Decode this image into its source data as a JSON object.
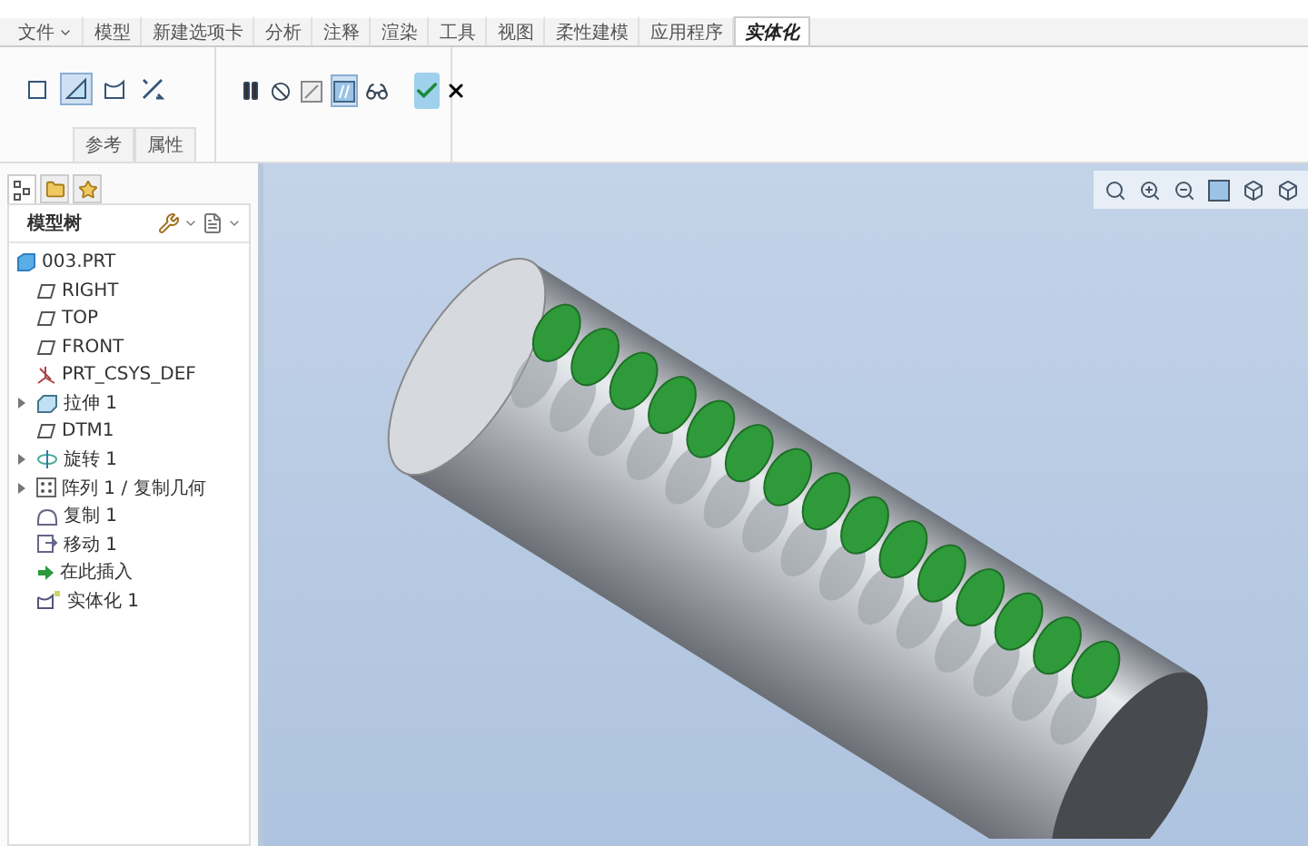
{
  "tabs": [
    {
      "label": "文件",
      "selected": false,
      "dropdown": true
    },
    {
      "label": "模型",
      "selected": false,
      "dropdown": false
    },
    {
      "label": "新建选项卡",
      "selected": false,
      "dropdown": false
    },
    {
      "label": "分析",
      "selected": false,
      "dropdown": false
    },
    {
      "label": "注释",
      "selected": false,
      "dropdown": false
    },
    {
      "label": "渲染",
      "selected": false,
      "dropdown": false
    },
    {
      "label": "工具",
      "selected": false,
      "dropdown": false
    },
    {
      "label": "视图",
      "selected": false,
      "dropdown": false
    },
    {
      "label": "柔性建模",
      "selected": false,
      "dropdown": false
    },
    {
      "label": "应用程序",
      "selected": false,
      "dropdown": false
    },
    {
      "label": "实体化",
      "selected": true,
      "dropdown": false
    }
  ],
  "ribbon": {
    "references_group": {
      "tools": [
        {
          "kind": "square",
          "selected": false
        },
        {
          "kind": "surface",
          "selected": true
        },
        {
          "kind": "curve",
          "selected": false
        },
        {
          "kind": "flip",
          "selected": false
        }
      ],
      "panel_tabs": [
        "参考",
        "属性"
      ]
    },
    "controls_group": {
      "tools": [
        {
          "kind": "pause",
          "selected": false
        },
        {
          "kind": "stop",
          "selected": false
        },
        {
          "kind": "preview",
          "selected": false
        },
        {
          "kind": "verify",
          "selected": true
        },
        {
          "kind": "glasses",
          "selected": false
        }
      ]
    }
  },
  "navigator": {
    "tabs": [
      {
        "kind": "tree",
        "selected": true
      },
      {
        "kind": "folder",
        "selected": false
      },
      {
        "kind": "favorites",
        "selected": false
      }
    ],
    "title": "模型树"
  },
  "tree": [
    {
      "kind": "part",
      "label": "003.PRT"
    },
    {
      "kind": "plane",
      "label": "RIGHT"
    },
    {
      "kind": "plane",
      "label": "TOP"
    },
    {
      "kind": "plane",
      "label": "FRONT"
    },
    {
      "kind": "csys",
      "label": "PRT_CSYS_DEF"
    },
    {
      "kind": "extrude",
      "label": "拉伸 1",
      "expanded": false
    },
    {
      "kind": "plane",
      "label": "DTM1"
    },
    {
      "kind": "revolve",
      "label": "旋转 1",
      "expanded": false
    },
    {
      "kind": "pattern",
      "label": "阵列 1 / 复制几何",
      "expanded": false
    },
    {
      "kind": "copy",
      "label": "复制 1"
    },
    {
      "kind": "move",
      "label": "移动 1"
    },
    {
      "kind": "insert",
      "label": "在此插入"
    },
    {
      "kind": "solidify",
      "label": "实体化 1"
    }
  ]
}
